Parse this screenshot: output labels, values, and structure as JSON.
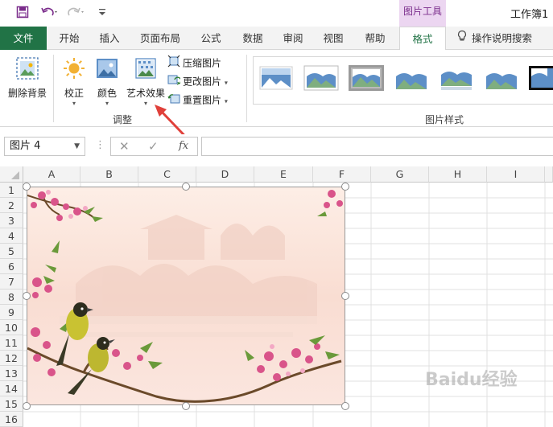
{
  "quick_access": {
    "save_icon": "save-icon",
    "undo_icon": "undo-icon",
    "redo_icon": "redo-icon",
    "customize_icon": "customize-qat-icon"
  },
  "context_tab": {
    "label": "图片工具"
  },
  "doc_title": "工作簿1",
  "tabs": [
    {
      "label": "文件"
    },
    {
      "label": "开始"
    },
    {
      "label": "插入"
    },
    {
      "label": "页面布局"
    },
    {
      "label": "公式"
    },
    {
      "label": "数据"
    },
    {
      "label": "审阅"
    },
    {
      "label": "视图"
    },
    {
      "label": "帮助"
    },
    {
      "label": "格式"
    }
  ],
  "tell_me": {
    "label": "操作说明搜索"
  },
  "ribbon": {
    "remove_bg": "删除背景",
    "corrections": "校正",
    "color": "颜色",
    "artistic": "艺术效果",
    "compress": "压缩图片",
    "change": "更改图片",
    "reset": "重置图片",
    "group_adjust": "调整",
    "group_styles": "图片样式"
  },
  "formula_bar": {
    "name_box": "图片 4",
    "cancel": "✕",
    "enter": "✓",
    "fx": "fx",
    "formula": ""
  },
  "columns": [
    "A",
    "B",
    "C",
    "D",
    "E",
    "F",
    "G",
    "H",
    "I"
  ],
  "rows": [
    "1",
    "2",
    "3",
    "4",
    "5",
    "6",
    "7",
    "8",
    "9",
    "10",
    "11",
    "12",
    "13",
    "14",
    "15",
    "16"
  ],
  "watermark": "Baidu经验",
  "colors": {
    "accent": "#217346",
    "context": "#7a2c8b",
    "arrow": "#e0403a"
  }
}
